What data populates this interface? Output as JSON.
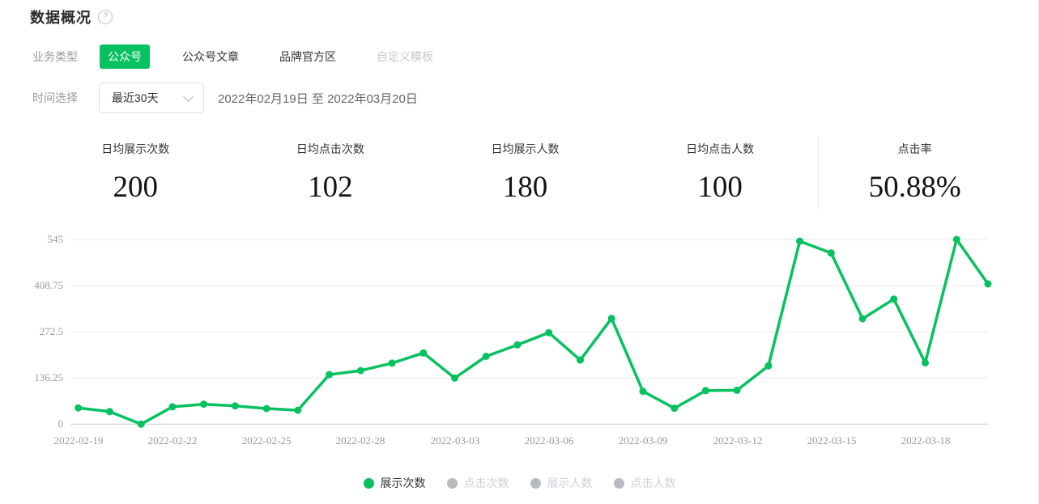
{
  "page": {
    "title": "数据概况",
    "help_glyph": "?"
  },
  "colors": {
    "accent_green": "#07C160",
    "inactive_gray": "#b8bcc2",
    "grid_line": "#e9e9e9",
    "axis_line": "#c7c7c7",
    "tick_text": "#999999"
  },
  "tabs": {
    "label": "业务类型",
    "items": [
      {
        "label": "公众号",
        "active": true
      },
      {
        "label": "公众号文章",
        "active": false
      },
      {
        "label": "品牌官方区",
        "active": false
      },
      {
        "label": "自定义模板",
        "active": false,
        "disabled": true
      }
    ]
  },
  "time": {
    "label": "时间选择",
    "selected_range": "最近30天",
    "date_range": "2022年02月19日 至 2022年03月20日"
  },
  "stats": [
    {
      "label": "日均展示次数",
      "value": "200"
    },
    {
      "label": "日均点击次数",
      "value": "102"
    },
    {
      "label": "日均展示人数",
      "value": "180"
    },
    {
      "label": "日均点击人数",
      "value": "100"
    },
    {
      "label": "点击率",
      "value": "50.88%"
    }
  ],
  "legend": {
    "items": [
      {
        "label": "展示次数",
        "active": true
      },
      {
        "label": "点击次数",
        "active": false
      },
      {
        "label": "展示人数",
        "active": false
      },
      {
        "label": "点击人数",
        "active": false
      }
    ]
  },
  "chart_data": {
    "type": "line",
    "title": "",
    "xlabel": "",
    "ylabel": "",
    "x": [
      "2022-02-19",
      "2022-02-20",
      "2022-02-21",
      "2022-02-22",
      "2022-02-23",
      "2022-02-24",
      "2022-02-25",
      "2022-02-26",
      "2022-02-27",
      "2022-02-28",
      "2022-03-01",
      "2022-03-02",
      "2022-03-03",
      "2022-03-04",
      "2022-03-05",
      "2022-03-06",
      "2022-03-07",
      "2022-03-08",
      "2022-03-09",
      "2022-03-10",
      "2022-03-11",
      "2022-03-12",
      "2022-03-13",
      "2022-03-14",
      "2022-03-15",
      "2022-03-16",
      "2022-03-17",
      "2022-03-18",
      "2022-03-19",
      "2022-03-20"
    ],
    "series": [
      {
        "name": "展示次数",
        "color": "#07C160",
        "visible": true,
        "values": [
          48,
          37,
          0,
          51,
          59,
          54,
          46,
          41,
          146,
          158,
          180,
          210,
          136,
          200,
          234,
          270,
          189,
          312,
          97,
          47,
          99,
          100,
          172,
          540,
          505,
          311,
          369,
          181,
          545,
          414
        ]
      },
      {
        "name": "点击次数",
        "visible": false
      },
      {
        "name": "展示人数",
        "visible": false
      },
      {
        "name": "点击人数",
        "visible": false
      }
    ],
    "ylim": [
      0,
      545
    ],
    "yticks": [
      0,
      136.25,
      272.5,
      408.75,
      545
    ],
    "ytick_labels": [
      "545",
      "408.75",
      "272.5",
      "136.25",
      "0"
    ],
    "xtick_labels": [
      "2022-02-19",
      "2022-02-22",
      "2022-02-25",
      "2022-02-28",
      "2022-03-03",
      "2022-03-06",
      "2022-03-09",
      "2022-03-12",
      "2022-03-15",
      "2022-03-18"
    ],
    "grid": true,
    "legend_position": "bottom"
  }
}
